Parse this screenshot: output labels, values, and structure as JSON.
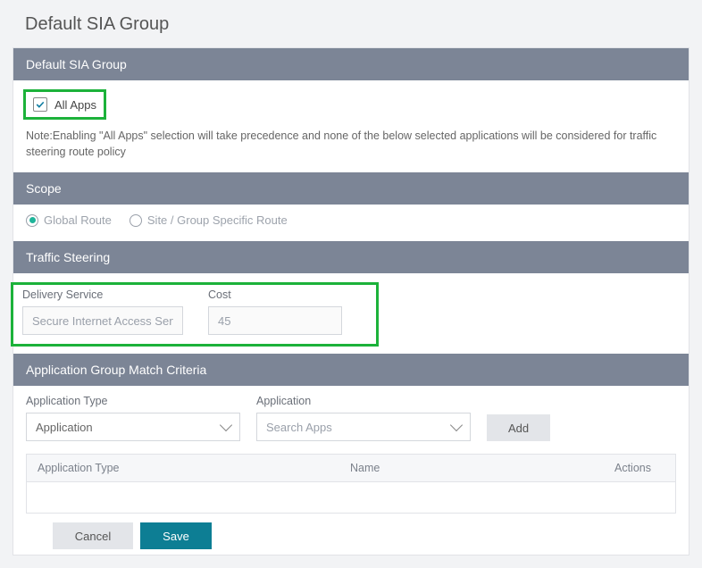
{
  "page": {
    "title": "Default SIA Group"
  },
  "group": {
    "header": "Default SIA Group",
    "all_apps": {
      "label": "All Apps",
      "checked": true
    },
    "note": "Note:Enabling \"All Apps\" selection will take precedence and none of the below selected applications will be considered for traffic steering route policy"
  },
  "scope": {
    "header": "Scope",
    "options": {
      "global": "Global Route",
      "site": "Site / Group Specific Route"
    },
    "selected": "global"
  },
  "traffic": {
    "header": "Traffic Steering",
    "delivery_label": "Delivery Service",
    "delivery_value": "Secure Internet Access Serv",
    "cost_label": "Cost",
    "cost_value": "45"
  },
  "criteria": {
    "header": "Application Group Match Criteria",
    "app_type_label": "Application Type",
    "app_type_value": "Application",
    "app_label": "Application",
    "app_placeholder": "Search Apps",
    "add_label": "Add",
    "table": {
      "col_type": "Application Type",
      "col_name": "Name",
      "col_actions": "Actions"
    }
  },
  "footer": {
    "cancel": "Cancel",
    "save": "Save"
  },
  "colors": {
    "highlight": "#1cb23a",
    "section_bar": "#7c8596",
    "primary_btn": "#0d7e94"
  }
}
